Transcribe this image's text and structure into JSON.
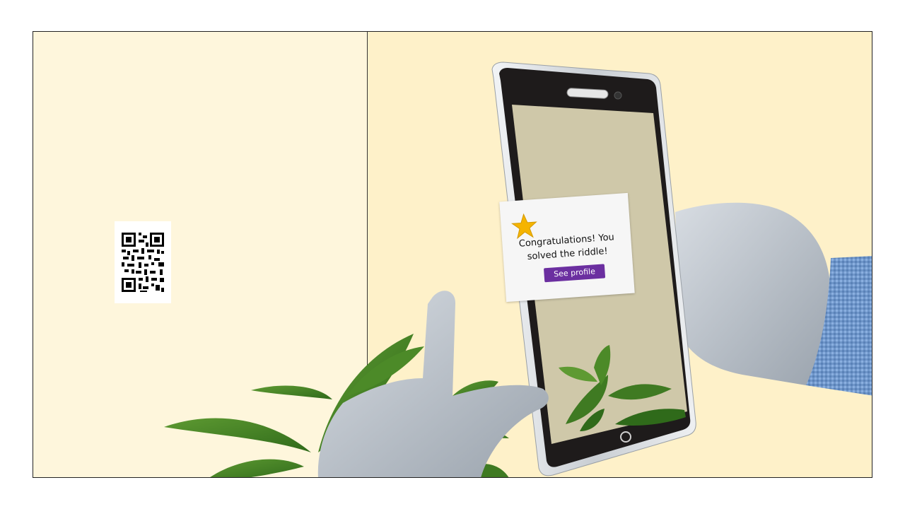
{
  "left_panel": {
    "qr_icon": "qr-code-icon"
  },
  "phone": {
    "popup": {
      "star_icon": "star-icon",
      "message_line1": "Congratulations! You",
      "message_line2": "solved the riddle!",
      "button_label": "See profile"
    }
  },
  "colors": {
    "background": "#fef1c9",
    "phone_screen": "#cfc8a9",
    "button": "#6b2fa0",
    "star": "#f5b400"
  }
}
